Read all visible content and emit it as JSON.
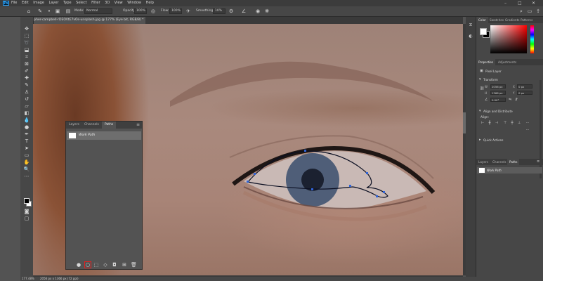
{
  "app": {
    "logo": "Ps",
    "menu": [
      "File",
      "Edit",
      "Image",
      "Layer",
      "Type",
      "Select",
      "Filter",
      "3D",
      "View",
      "Window",
      "Help"
    ],
    "window_controls": [
      "–",
      "□",
      "✕"
    ]
  },
  "options_bar": {
    "mode_label": "Mode:",
    "mode_value": "Normal",
    "opacity_label": "Opacity:",
    "opacity_value": "100%",
    "flow_label": "Flow:",
    "flow_value": "100%",
    "smoothing_label": "Smoothing:",
    "smoothing_value": "10%"
  },
  "document_tab": {
    "title": "christopher-campbell-rDEOVtE7vOs-unsplash.jpg @ 177% (Eye bit, RGB/8) *",
    "close": "×"
  },
  "paths_panel_float": {
    "tabs": [
      "Layers",
      "Channels",
      "Paths"
    ],
    "active_tab": "Paths",
    "items": [
      {
        "name": "Work Path"
      }
    ],
    "bottom_tools": [
      "fill-path",
      "stroke-path",
      "load-as-selection",
      "make-work-path",
      "add-mask",
      "new-path",
      "delete-path"
    ]
  },
  "right_panel": {
    "color_tabs": [
      "Color",
      "Swatches",
      "Gradients",
      "Patterns"
    ],
    "color_active": "Color",
    "fg_color": "#ffffff",
    "bg_color": "#000000",
    "properties_tabs": [
      "Properties",
      "Adjustments"
    ],
    "properties_active": "Properties",
    "property_kind": "Pixel Layer",
    "transform_label": "Transform",
    "fields": {
      "w": "2056 px",
      "h": "1366 px",
      "x": "0 px",
      "y": "0 px",
      "angle": "0.00°"
    },
    "align_label": "Align and Distribute",
    "align_sub": "Align:",
    "quick_actions_label": "Quick Actions",
    "bottom_tabs": [
      "Layers",
      "Channels",
      "Paths"
    ],
    "bottom_active": "Paths",
    "bottom_items": [
      {
        "name": "Work Path"
      }
    ]
  },
  "status_bar": {
    "zoom": "177.48%",
    "doc_info": "2056 px x 1366 px (72 ppi)"
  }
}
